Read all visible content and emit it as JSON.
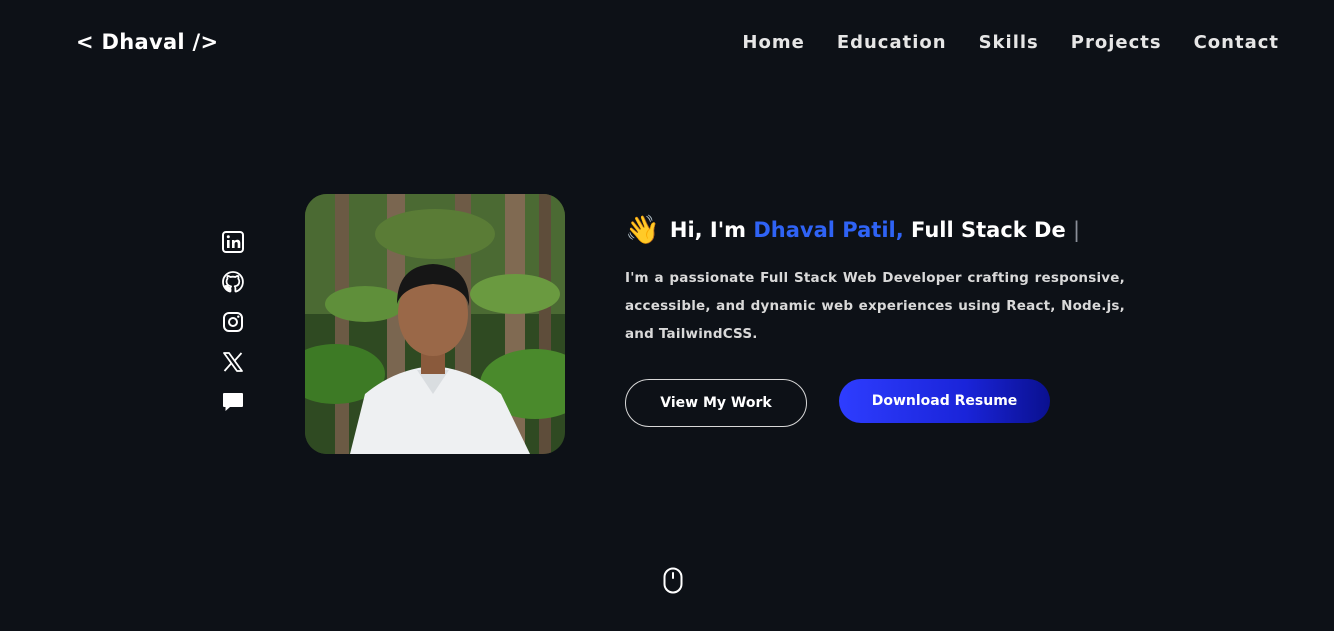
{
  "header": {
    "logo": "< Dhaval />",
    "nav": [
      "Home",
      "Education",
      "Skills",
      "Projects",
      "Contact"
    ]
  },
  "social": {
    "icons": [
      "linkedin-icon",
      "github-icon",
      "instagram-icon",
      "x-icon",
      "chat-icon"
    ]
  },
  "hero": {
    "wave_emoji": "👋",
    "greeting_prefix": "Hi, I'm",
    "name": "Dhaval Patil,",
    "typed_role": "Full Stack De",
    "cursor": "|",
    "bio": "I'm a passionate Full Stack Web Developer crafting responsive, accessible, and dynamic web experiences using React, Node.js, and TailwindCSS.",
    "buttons": {
      "view_work": "View My Work",
      "download_resume": "Download Resume"
    }
  },
  "colors": {
    "background": "#0d1117",
    "accent": "#2f63f5",
    "button_gradient_start": "#2e3dff",
    "button_gradient_end": "#0a108f"
  },
  "scroll_indicator": "mouse-icon"
}
